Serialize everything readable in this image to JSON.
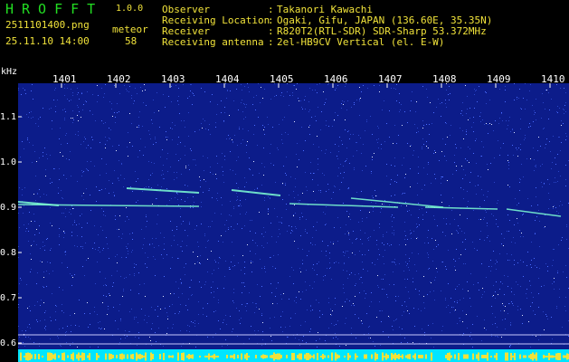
{
  "header": {
    "app_logo": "HROFFT",
    "version": "1.0.0",
    "filename": "2511101400.png",
    "datetime": "25.11.10 14:00",
    "meteor_label": "meteor",
    "meteor_count": "58",
    "info": [
      {
        "label": "Observer",
        "value": "Takanori Kawachi"
      },
      {
        "label": "Receiving Location",
        "value": "Ogaki, Gifu, JAPAN (136.60E, 35.35N)"
      },
      {
        "label": "Receiver",
        "value": "R820T2(RTL-SDR) SDR-Sharp 53.372MHz"
      },
      {
        "label": "Receiving antenna",
        "value": "2el-HB9CV Vertical (el. E-W)"
      }
    ]
  },
  "spectrogram": {
    "freq_unit": "kHz",
    "y_ticks": [
      "1.1",
      "1.0",
      "0.9",
      "0.8",
      "0.7",
      "0.6"
    ],
    "x_ticks": [
      "1401",
      "1402",
      "1403",
      "1404",
      "1405",
      "1406",
      "1407",
      "1408",
      "1409",
      "1410"
    ],
    "colors": {
      "background": "#0c1c8a",
      "noise": "#4a6cff",
      "echo": "#7fffd4",
      "level_bar": "#00e5ff",
      "level_peaks": "#f0e23a"
    }
  }
}
